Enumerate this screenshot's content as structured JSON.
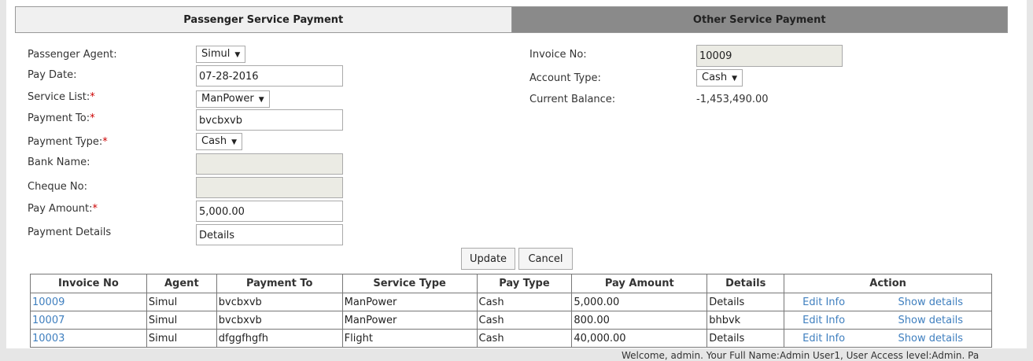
{
  "tabs": {
    "passenger": "Passenger Service Payment",
    "other": "Other Service Payment"
  },
  "form": {
    "passenger_agent": {
      "label": "Passenger Agent:",
      "value": "Simul"
    },
    "pay_date": {
      "label": "Pay Date:",
      "value": "07-28-2016"
    },
    "service_list": {
      "label": "Service List:",
      "value": "ManPower"
    },
    "payment_to": {
      "label": "Payment To:",
      "value": "bvcbxvb"
    },
    "payment_type": {
      "label": "Payment Type:",
      "value": "Cash"
    },
    "bank_name": {
      "label": "Bank Name:",
      "value": ""
    },
    "cheque_no": {
      "label": "Cheque No:",
      "value": ""
    },
    "pay_amount": {
      "label": "Pay Amount:",
      "value": "5,000.00"
    },
    "payment_details": {
      "label": "Payment Details",
      "value": "Details"
    },
    "invoice_no": {
      "label": "Invoice No:",
      "value": "10009"
    },
    "account_type": {
      "label": "Account Type:",
      "value": "Cash"
    },
    "current_balance": {
      "label": "Current Balance:",
      "value": "-1,453,490.00"
    },
    "required_mark": "*"
  },
  "buttons": {
    "update": "Update",
    "cancel": "Cancel"
  },
  "table": {
    "headers": [
      "Invoice No",
      "Agent",
      "Payment To",
      "Service Type",
      "Pay Type",
      "Pay Amount",
      "Details",
      "Action"
    ],
    "rows": [
      {
        "invoice": "10009",
        "agent": "Simul",
        "payment_to": "bvcbxvb",
        "service_type": "ManPower",
        "pay_type": "Cash",
        "pay_amount": "5,000.00",
        "details": "Details",
        "edit": "Edit Info",
        "show": "Show details"
      },
      {
        "invoice": "10007",
        "agent": "Simul",
        "payment_to": "bvcbxvb",
        "service_type": "ManPower",
        "pay_type": "Cash",
        "pay_amount": "800.00",
        "details": "bhbvk",
        "edit": "Edit Info",
        "show": "Show details"
      },
      {
        "invoice": "10003",
        "agent": "Simul",
        "payment_to": "dfggfhgfh",
        "service_type": "Flight",
        "pay_type": "Cash",
        "pay_amount": "40,000.00",
        "details": "Details",
        "edit": "Edit Info",
        "show": "Show details"
      }
    ]
  },
  "footer": {
    "text": "Welcome, admin. Your Full Name:Admin User1, User Access level:Admin. Pa"
  },
  "colors": {
    "link": "#3f7fbf",
    "required": "#cc0000",
    "inactive_tab": "#8a8a8a"
  }
}
